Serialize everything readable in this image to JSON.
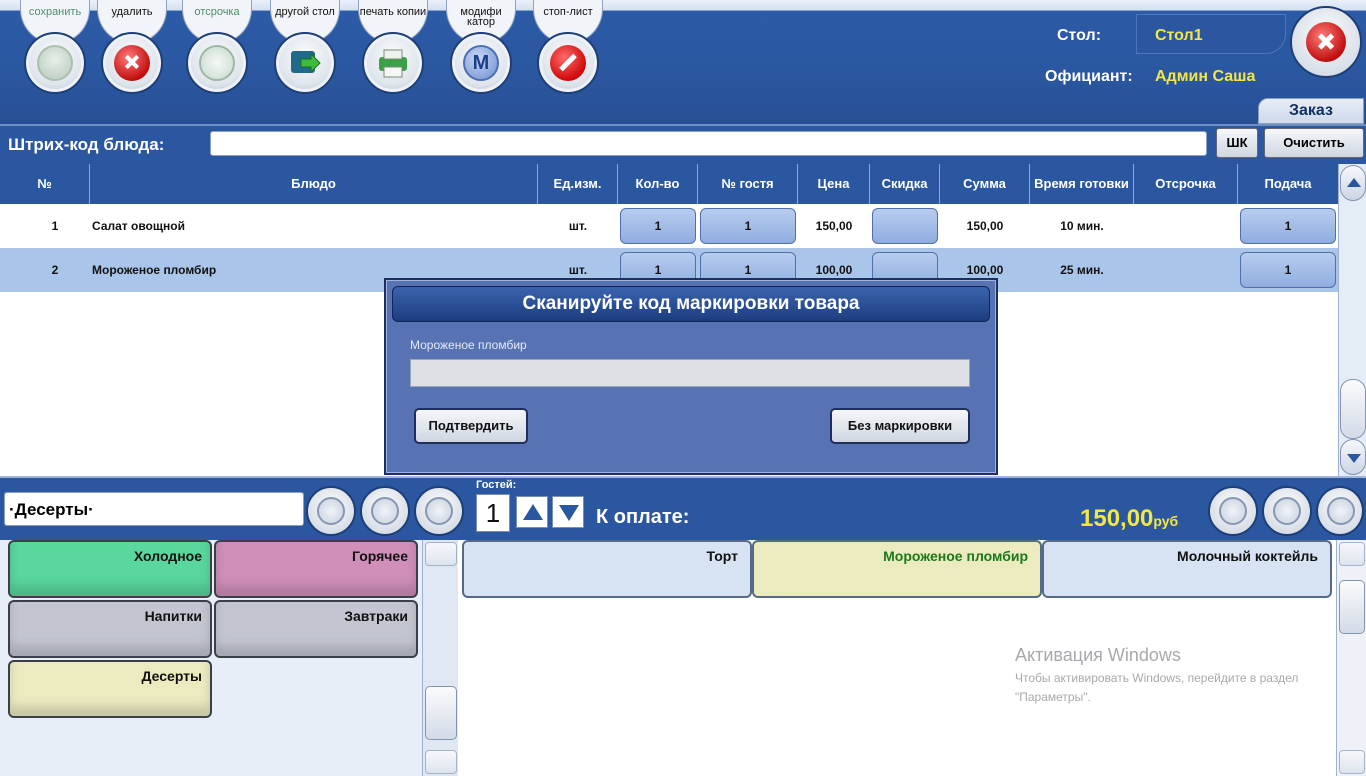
{
  "toolbar": {
    "buttons": [
      {
        "label": "сохранить",
        "icon": "check-icon"
      },
      {
        "label": "удалить",
        "icon": "delete-icon"
      },
      {
        "label": "отсрочка",
        "icon": "clock-icon"
      },
      {
        "label": "другой стол",
        "icon": "move-table-icon"
      },
      {
        "label": "печать копии",
        "icon": "printer-icon"
      },
      {
        "label": "модифи катор",
        "icon": "modifier-icon"
      },
      {
        "label": "стоп-лист",
        "icon": "stop-icon"
      }
    ]
  },
  "header": {
    "table_label": "Стол:",
    "table_value": "Стол1",
    "waiter_label": "Официант:",
    "waiter_value": "Админ Саша",
    "tab_order": "Заказ"
  },
  "barcode": {
    "label": "Штрих-код блюда:",
    "value": "",
    "shk_button": "ШК",
    "clear_button": "Очистить"
  },
  "order_table": {
    "columns": [
      "№",
      "Блюдо",
      "Ед.изм.",
      "Кол-во",
      "№ гостя",
      "Цена",
      "Скидка",
      "Сумма",
      "Время готовки",
      "Отсрочка",
      "Подача"
    ],
    "rows": [
      {
        "num": "1",
        "dish": "Салат овощной",
        "unit": "шт.",
        "qty": "1",
        "guest": "1",
        "price": "150,00",
        "discount": "",
        "sum": "150,00",
        "time": "10 мин.",
        "delay": "",
        "serve": "1"
      },
      {
        "num": "2",
        "dish": "Мороженое пломбир",
        "unit": "шт.",
        "qty": "1",
        "guest": "1",
        "price": "100,00",
        "discount": "",
        "sum": "100,00",
        "time": "25 мин.",
        "delay": "",
        "serve": "1"
      }
    ]
  },
  "dialog": {
    "title": "Сканируйте код маркировки товара",
    "item_name": "Мороженое пломбир",
    "input_value": "",
    "confirm_button": "Подтвердить",
    "no_mark_button": "Без маркировки"
  },
  "middle": {
    "category_path": "·Десерты·",
    "guests_label": "Гостей:",
    "guests_value": "1",
    "to_pay_label": "К оплате:",
    "to_pay_amount": "150,00",
    "currency": "руб"
  },
  "categories": [
    {
      "label": "Холодное",
      "color": "#59d79c"
    },
    {
      "label": "Горячее",
      "color": "#cf8fb8"
    },
    {
      "label": "Напитки",
      "color": "#c3c6d0"
    },
    {
      "label": "Завтраки",
      "color": "#c3c6d0"
    },
    {
      "label": "Десерты",
      "color": "#ecebc0"
    }
  ],
  "menu_items": [
    {
      "label": "Торт",
      "color": "#d7e3f3",
      "text_color": "#111111"
    },
    {
      "label": "Мороженое пломбир",
      "color": "#ecebc0",
      "text_color": "#1a7a1a"
    },
    {
      "label": "Молочный коктейль",
      "color": "#d7e3f3",
      "text_color": "#111111"
    }
  ],
  "watermark": {
    "title": "Активация Windows",
    "text": "Чтобы активировать Windows, перейдите в раздел \"Параметры\"."
  },
  "colors": {
    "primary": "#2b57a0",
    "accent_yellow": "#f3e646",
    "selected_row": "#a9c5ea"
  }
}
